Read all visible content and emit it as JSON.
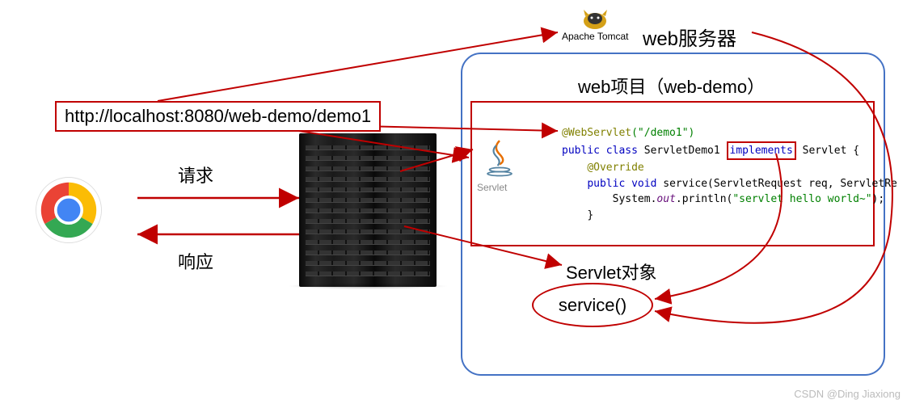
{
  "url": "http://localhost:8080/web-demo/demo1",
  "labels": {
    "web_server": "web服务器",
    "web_project": "web项目（web-demo）",
    "request": "请求",
    "response": "响应",
    "servlet_object": "Servlet对象",
    "service": "service()",
    "tomcat": "Apache Tomcat",
    "servlet": "Servlet"
  },
  "code": {
    "annotation_kw": "@WebServlet",
    "annotation_arg": "(\"/demo1\")",
    "pub": "public",
    "cls": "class",
    "clsname": " ServletDemo1 ",
    "impl": "implements",
    "srvlt": " Servlet {",
    "override": "@Override",
    "void": "void",
    "service": "service",
    "params": "(ServletRequest req, ServletRe",
    "sysout_a": "System.",
    "sysout_b": "out",
    "sysout_c": ".println(",
    "sysout_d": "\"servlet hello world~\"",
    "sysout_e": ");",
    "close": "}"
  },
  "watermark": "CSDN @Ding Jiaxiong"
}
